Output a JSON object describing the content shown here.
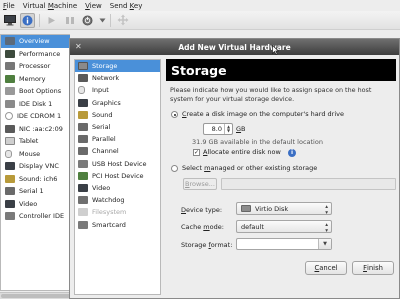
{
  "menubar": {
    "items": [
      {
        "pre": "",
        "u": "F",
        "post": "ile"
      },
      {
        "pre": "Virtual ",
        "u": "M",
        "post": "achine"
      },
      {
        "pre": "",
        "u": "V",
        "post": "iew"
      },
      {
        "pre": "Send ",
        "u": "K",
        "post": "ey"
      }
    ]
  },
  "toolbar": {
    "icons": [
      "monitor-icon",
      "info-icon",
      "run-icon",
      "pause-icon",
      "power-icon",
      "dropdown-icon",
      "move-icon"
    ]
  },
  "vm_details": {
    "items": [
      {
        "label": "Overview",
        "selected": true
      },
      {
        "label": "Performance"
      },
      {
        "label": "Processor"
      },
      {
        "label": "Memory"
      },
      {
        "label": "Boot Options"
      },
      {
        "label": "IDE Disk 1"
      },
      {
        "label": "IDE CDROM 1"
      },
      {
        "label": "NIC :aa:c2:09"
      },
      {
        "label": "Tablet"
      },
      {
        "label": "Mouse"
      },
      {
        "label": "Display VNC"
      },
      {
        "label": "Sound: ich6"
      },
      {
        "label": "Serial 1"
      },
      {
        "label": "Video"
      },
      {
        "label": "Controller IDE"
      }
    ]
  },
  "dialog": {
    "title": "Add New Virtual Hardware",
    "hardware_list": [
      {
        "label": "Storage",
        "selected": true
      },
      {
        "label": "Network"
      },
      {
        "label": "Input"
      },
      {
        "label": "Graphics"
      },
      {
        "label": "Sound"
      },
      {
        "label": "Serial"
      },
      {
        "label": "Parallel"
      },
      {
        "label": "Channel"
      },
      {
        "label": "USB Host Device"
      },
      {
        "label": "PCI Host Device"
      },
      {
        "label": "Video"
      },
      {
        "label": "Watchdog"
      },
      {
        "label": "Filesystem",
        "disabled": true
      },
      {
        "label": "Smartcard"
      }
    ],
    "storage": {
      "header": "Storage",
      "description": "Please indicate how you would like to assign space on the host system for your virtual storage device.",
      "create_option": {
        "pre": "",
        "u": "C",
        "post": "reate a disk image on the computer's hard drive",
        "checked": true
      },
      "size_value": "8.0",
      "size_unit": {
        "u": "G",
        "post": "B"
      },
      "available_text": "31.9 GB available in the default location",
      "allocate": {
        "pre": "",
        "u": "A",
        "post": "llocate entire disk now",
        "checked": true
      },
      "select_option": {
        "pre": "Select ",
        "u": "m",
        "post": "anaged or other existing storage",
        "checked": false
      },
      "browse_label": {
        "u": "B",
        "post": "rowse..."
      },
      "path_value": "",
      "device_type": {
        "label_pre": "",
        "label_u": "D",
        "label_post": "evice type:",
        "value": "Virtio Disk"
      },
      "cache_mode": {
        "label_pre": "Cache ",
        "label_u": "m",
        "label_post": "ode:",
        "value": "default"
      },
      "storage_format": {
        "label_pre": "Storage ",
        "label_u": "f",
        "label_post": "ormat:",
        "value": ""
      },
      "info_icon": "info-icon"
    },
    "buttons": {
      "cancel": {
        "u": "C",
        "post": "ancel"
      },
      "finish": {
        "u": "F",
        "post": "inish"
      }
    }
  },
  "colors": {
    "selection": "#4a90d9",
    "titlebar": "#3d3d3d",
    "header_bg": "#000000"
  }
}
